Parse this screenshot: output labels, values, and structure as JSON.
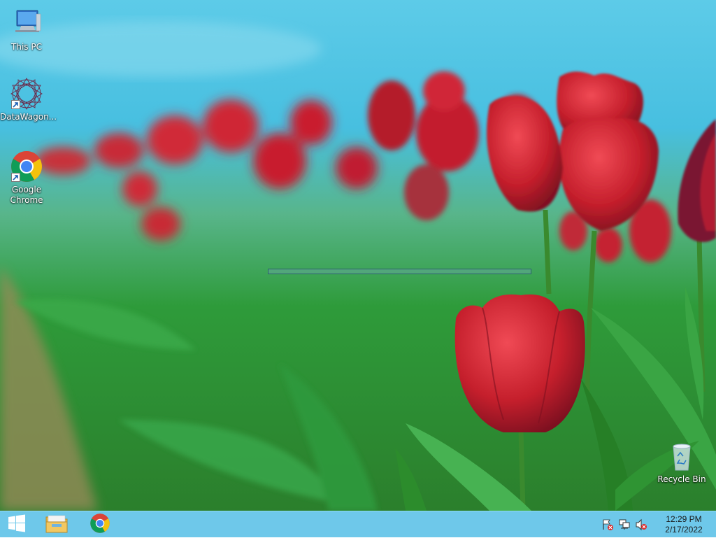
{
  "desktop": {
    "icons": [
      {
        "label": "This PC",
        "icon": "this-pc-icon"
      },
      {
        "label": "DataWagon...",
        "icon": "datawagon-icon"
      },
      {
        "label": "Google Chrome",
        "icon": "chrome-icon"
      },
      {
        "label": "Recycle Bin",
        "icon": "recycle-bin-icon"
      }
    ]
  },
  "taskbar": {
    "items": [
      {
        "icon": "start-windows-icon"
      },
      {
        "icon": "file-explorer-icon"
      },
      {
        "icon": "chrome-icon"
      }
    ],
    "tray": {
      "icons": [
        "action-center-flag-icon",
        "network-icon",
        "volume-muted-icon"
      ],
      "time": "12:29 PM",
      "date": "2/17/2022"
    }
  },
  "colors": {
    "taskbar": "#6ec8ea",
    "sky": "#5ec9e6",
    "tulip_red": "#c8202e",
    "leaf_green": "#2f9a3c"
  }
}
